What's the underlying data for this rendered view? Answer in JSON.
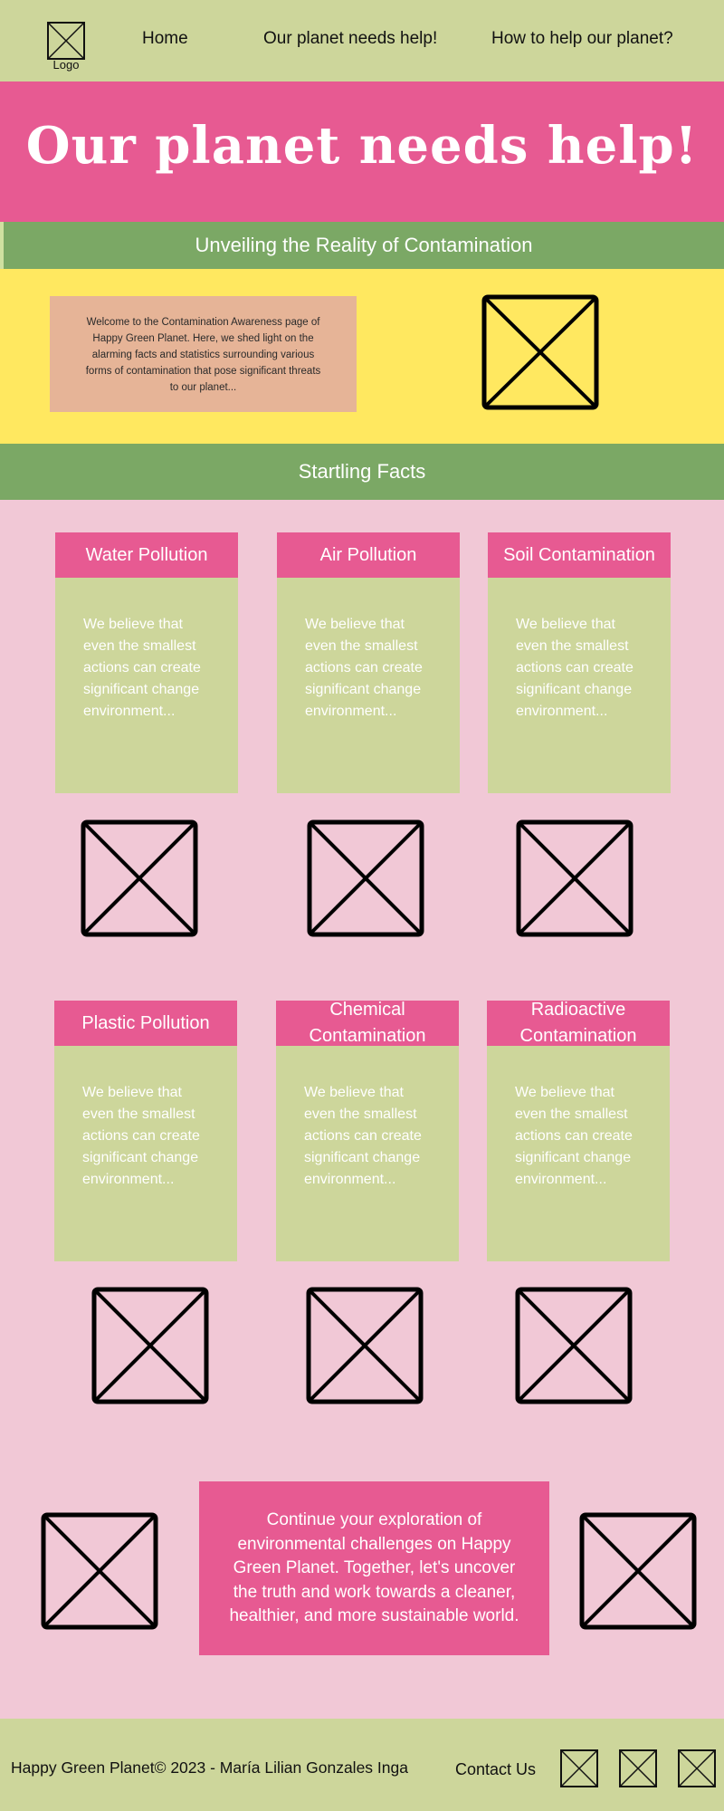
{
  "header": {
    "logo_label": "Logo",
    "nav": [
      {
        "label": "Home"
      },
      {
        "label": "Our planet needs help!"
      },
      {
        "label": "How to help our planet?"
      }
    ]
  },
  "hero": {
    "title": "Our planet needs help!"
  },
  "section1": {
    "heading": "Unveiling the Reality of Contamination",
    "intro_text": "Welcome to the Contamination Awareness page of Happy Green Planet. Here, we shed light on the alarming facts and statistics surrounding various forms of contamination that pose significant threats to our planet..."
  },
  "section2": {
    "heading": "Startling Facts",
    "cards": [
      {
        "title": "Water Pollution",
        "body": "We believe that even the smallest actions can create significant change environment..."
      },
      {
        "title": "Air Pollution",
        "body": "We believe that even the smallest actions can create significant change environment..."
      },
      {
        "title": "Soil Contamination",
        "body": "We believe that even the smallest actions can create significant change environment..."
      },
      {
        "title": "Plastic Pollution",
        "body": "We believe that even the smallest actions can create significant change environment..."
      },
      {
        "title": "Chemical Contamination",
        "body": "We believe that even the smallest actions can create significant change environment..."
      },
      {
        "title": "Radioactive Contamination",
        "body": "We believe that even the smallest actions can create significant change environment..."
      }
    ]
  },
  "cta": {
    "text": "Continue your exploration of environmental challenges on Happy Green Planet. Together, let's uncover the truth and work towards a cleaner, healthier, and more sustainable world."
  },
  "footer": {
    "copyright": "Happy Green Planet© 2023 - María Lilian Gonzales Inga",
    "contact_label": "Contact Us"
  },
  "colors": {
    "header_bg": "#cdd69b",
    "accent_pink": "#e75a92",
    "accent_green": "#7ba865",
    "intro_yellow": "#ffe860",
    "page_bg": "#f1c8d6"
  }
}
